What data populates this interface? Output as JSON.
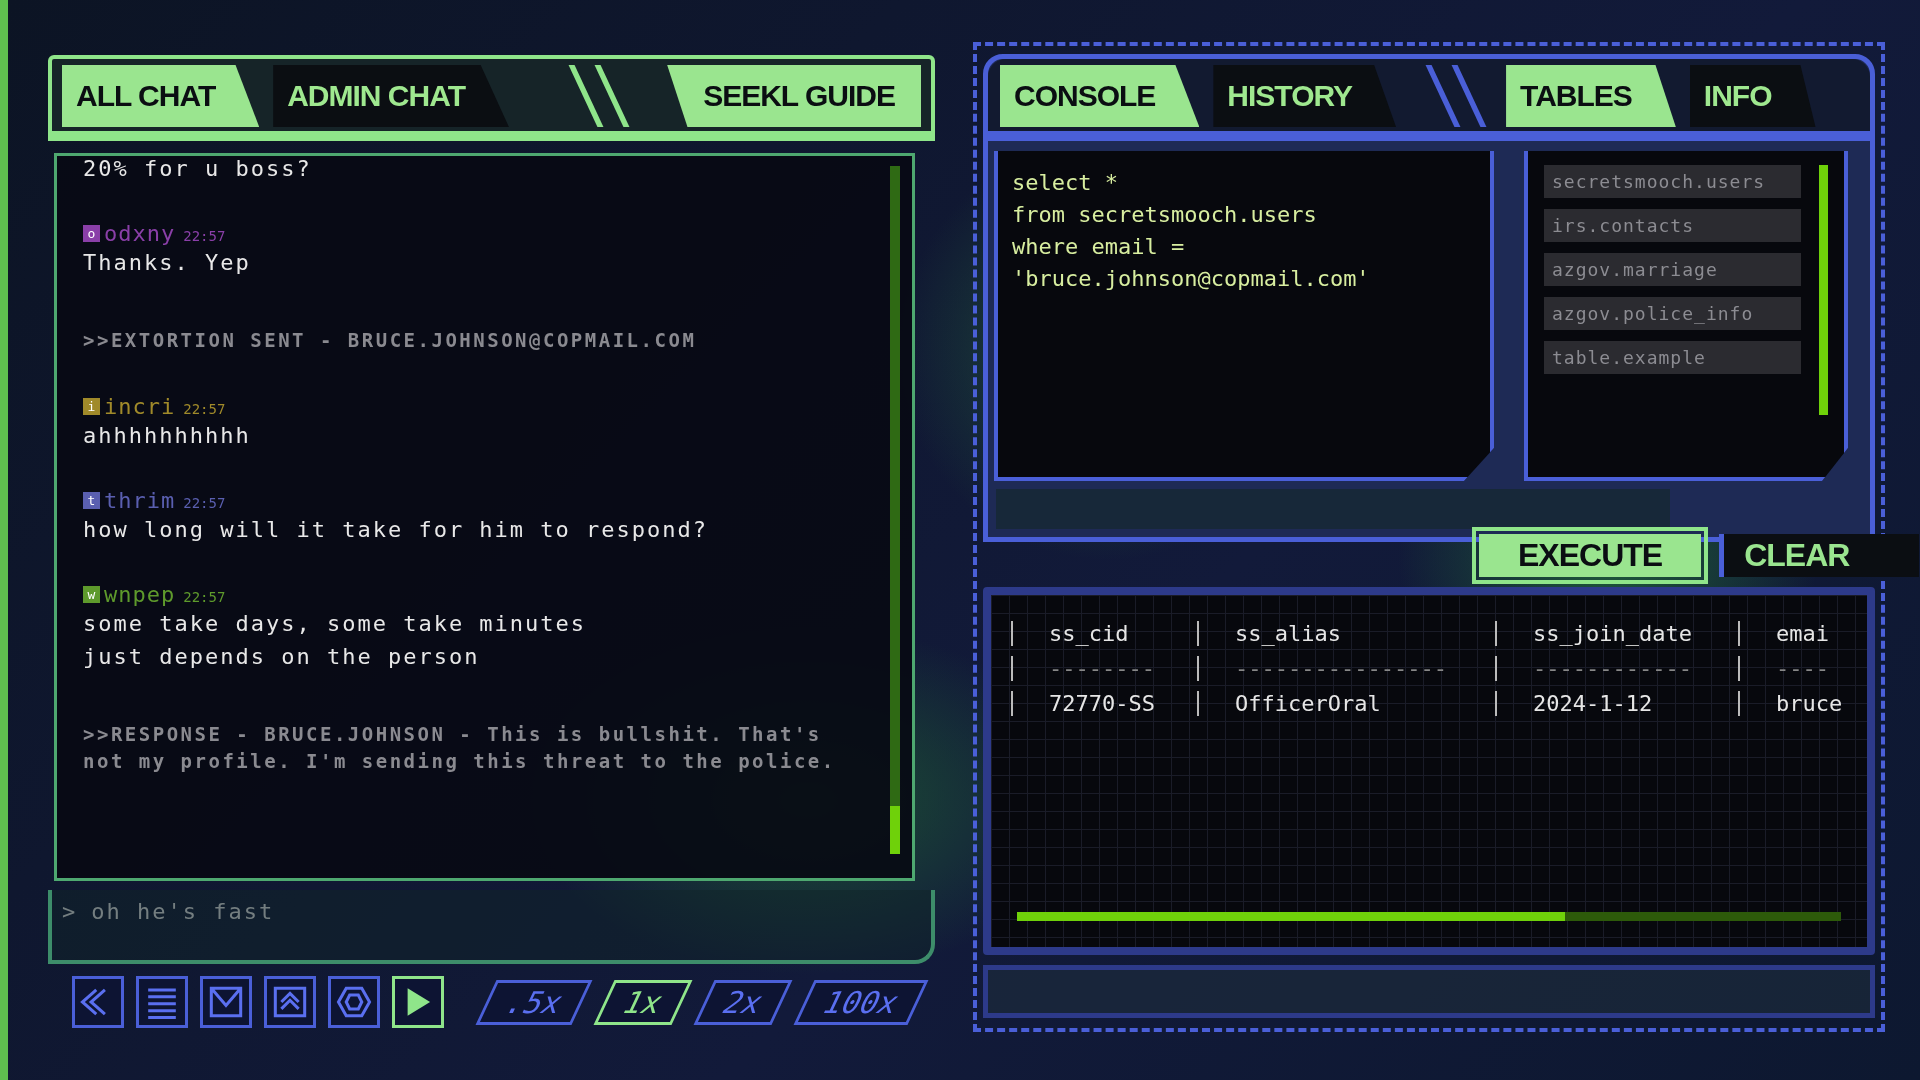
{
  "chat_tabs": [
    {
      "label": "ALL CHAT",
      "selected": true
    },
    {
      "label": "ADMIN CHAT",
      "selected": false
    }
  ],
  "guide_tab": {
    "label": "SEEKL GUIDE"
  },
  "messages": [
    {
      "kind": "text",
      "lines": [
        "20% for u boss?"
      ]
    },
    {
      "kind": "message",
      "initial": "o",
      "user": "odxny",
      "time": "22:57",
      "color": "#8a3fa8",
      "lines": [
        "Thanks. Yep"
      ]
    },
    {
      "kind": "system",
      "text": ">>EXTORTION SENT -  BRUCE.JOHNSON@COPMAIL.COM"
    },
    {
      "kind": "message",
      "initial": "i",
      "user": "incri",
      "time": "22:57",
      "color": "#a08a2a",
      "lines": [
        "ahhhhhhhhhh"
      ]
    },
    {
      "kind": "message",
      "initial": "t",
      "user": "thrim",
      "time": "22:57",
      "color": "#5a5fb0",
      "lines": [
        "how long will it take for him to respond?"
      ]
    },
    {
      "kind": "message",
      "initial": "w",
      "user": "wnpep",
      "time": "22:57",
      "color": "#5e9a2c",
      "lines": [
        "some take days, some take minutes",
        "just depends on the person"
      ]
    },
    {
      "kind": "system",
      "text": ">>RESPONSE - BRUCE.JOHNSON - This is bullshit. That's not my profile. I'm sending this threat to the police."
    }
  ],
  "chat_input": {
    "prompt": ">",
    "value": "oh he's fast"
  },
  "toolbar": [
    {
      "kind": "rewind",
      "selected": false
    },
    {
      "kind": "list",
      "selected": false
    },
    {
      "kind": "mail",
      "selected": false
    },
    {
      "kind": "upload",
      "selected": false
    },
    {
      "kind": "hexagon",
      "selected": false
    },
    {
      "kind": "play",
      "selected": true
    }
  ],
  "speeds": [
    {
      "label": ".5x",
      "selected": false
    },
    {
      "label": "1x",
      "selected": true
    },
    {
      "label": "2x",
      "selected": false
    },
    {
      "label": "100x",
      "selected": false
    }
  ],
  "console_tabs": [
    {
      "label": "CONSOLE",
      "selected": true
    },
    {
      "label": "HISTORY",
      "selected": false
    }
  ],
  "side_tabs": [
    {
      "label": "TABLES",
      "selected": true
    },
    {
      "label": "INFO",
      "selected": false
    }
  ],
  "query": [
    "select *",
    "from secretsmooch.users",
    "where email =",
    "'bruce.johnson@copmail.com'"
  ],
  "tables": [
    "secretsmooch.users",
    "irs.contacts",
    "azgov.marriage",
    "azgov.police_info",
    "table.example"
  ],
  "buttons": {
    "execute": "EXECUTE",
    "clear": "CLEAR"
  },
  "results": {
    "columns": [
      "ss_cid",
      "ss_alias",
      "ss_join_date",
      "emai"
    ],
    "rows": [
      [
        "--------",
        "----------------",
        "------------",
        "----"
      ],
      [
        "72770-SS",
        "OfficerOral",
        "2024-1-12",
        "bruce"
      ]
    ]
  },
  "progress": {
    "level": 0.665
  }
}
